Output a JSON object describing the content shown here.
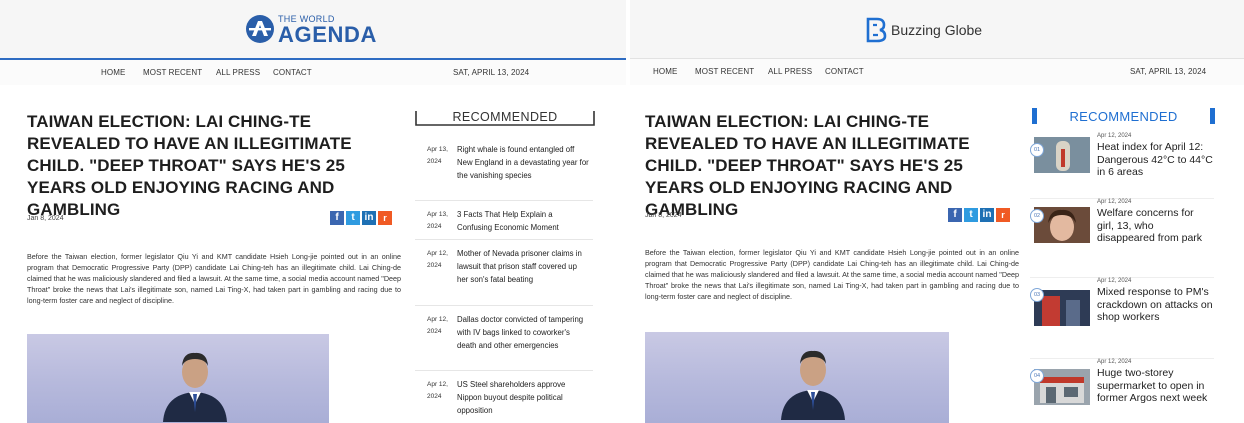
{
  "left": {
    "logo": {
      "small": "THE WORLD",
      "big": "AGENDA"
    },
    "nav": {
      "items": [
        "HOME",
        "MOST RECENT",
        "ALL PRESS",
        "CONTACT"
      ],
      "date": "SAT, APRIL 13, 2024"
    },
    "headline": "TAIWAN ELECTION: LAI CHING-TE REVEALED TO HAVE AN ILLEGITIMATE CHILD. \"DEEP THROAT\" SAYS HE'S 25 YEARS OLD ENJOYING RACING AND GAMBLING",
    "article_date": "Jan 8, 2024",
    "body": "Before the Taiwan election, former legislator Qiu Yi and KMT candidate Hsieh Long-jie pointed out in an online program that Democratic Progressive Party (DPP) candidate Lai Ching-teh has an illegitimate child. Lai Ching-de claimed that he was maliciously slandered and filed a lawsuit. At the same time, a social media account named \"Deep Throat\" broke the news that Lai's illegitimate son, named Lai Ting-X, had taken part in gambling and racing due to long-term foster care and neglect of discipline.",
    "recommended_title": "RECOMMENDED",
    "recommended": [
      {
        "date_top": "Apr 13,",
        "date_bottom": "2024",
        "title": "Right whale is found entangled off New England in a devastating year for the vanishing species"
      },
      {
        "date_top": "Apr 13,",
        "date_bottom": "2024",
        "title": "3 Facts That Help Explain a Confusing Economic Moment"
      },
      {
        "date_top": "Apr 12,",
        "date_bottom": "2024",
        "title": "Mother of Nevada prisoner claims in lawsuit that prison staff covered up her son's fatal beating"
      },
      {
        "date_top": "Apr 12,",
        "date_bottom": "2024",
        "title": "Dallas doctor convicted of tampering with IV bags linked to coworker's death and other emergencies"
      },
      {
        "date_top": "Apr 12,",
        "date_bottom": "2024",
        "title": "US Steel shareholders approve Nippon buyout despite political opposition"
      }
    ]
  },
  "right": {
    "logo": {
      "text": "Buzzing Globe"
    },
    "nav": {
      "items": [
        "HOME",
        "MOST RECENT",
        "ALL PRESS",
        "CONTACT"
      ],
      "date": "SAT, APRIL 13, 2024"
    },
    "headline": "TAIWAN ELECTION: LAI CHING-TE REVEALED TO HAVE AN ILLEGITIMATE CHILD. \"DEEP THROAT\" SAYS HE'S 25 YEARS OLD ENJOYING RACING AND GAMBLING",
    "article_date": "Jan 8, 2024",
    "body": "Before the Taiwan election, former legislator Qiu Yi and KMT candidate Hsieh Long-jie pointed out in an online program that Democratic Progressive Party (DPP) candidate Lai Ching-teh has an illegitimate child. Lai Ching-de claimed that he was maliciously slandered and filed a lawsuit. At the same time, a social media account named \"Deep Throat\" broke the news that Lai's illegitimate son, named Lai Ting-X, had taken part in gambling and racing due to long-term foster care and neglect of discipline.",
    "recommended_title": "RECOMMENDED",
    "recommended": [
      {
        "num": "01",
        "date": "Apr 12, 2024",
        "title": "Heat index for April 12: Dangerous 42°C to 44°C in 6 areas"
      },
      {
        "num": "02",
        "date": "Apr 12, 2024",
        "title": "Welfare concerns for girl, 13, who disappeared from park"
      },
      {
        "num": "03",
        "date": "Apr 12, 2024",
        "title": "Mixed response to PM's crackdown on attacks on shop workers"
      },
      {
        "num": "04",
        "date": "Apr 12, 2024",
        "title": "Huge two-storey supermarket to open in former Argos next week"
      }
    ]
  },
  "share": {
    "fb": "f",
    "tw": "t",
    "li": "in",
    "rd": "r"
  },
  "colors": {
    "accent_left": "#2e6cc2",
    "accent_right": "#1f6fd1",
    "facebook": "#3b66b0",
    "twitter": "#2f9be0",
    "linkedin": "#1e70b4",
    "reddit": "#f05a24"
  },
  "icons": [
    "globe-emblem-icon",
    "buzzing-globe-b-icon",
    "facebook-icon",
    "twitter-icon",
    "linkedin-icon",
    "reddit-icon"
  ]
}
